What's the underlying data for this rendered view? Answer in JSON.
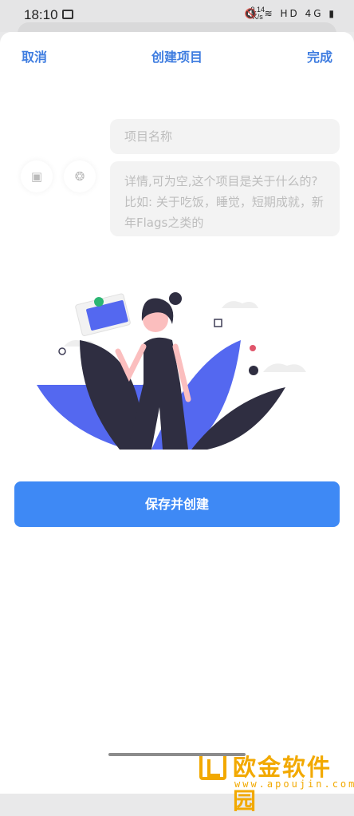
{
  "status": {
    "time": "18:10",
    "net_speed_top": "9.14",
    "net_speed_bottom": "K/s",
    "hd": "HD",
    "signal": "4G"
  },
  "header": {
    "cancel": "取消",
    "title": "创建项目",
    "done": "完成"
  },
  "form": {
    "name_placeholder": "项目名称",
    "desc_placeholder": "详情,可为空,这个项目是关于什么的? 比如: 关于吃饭，睡觉，短期成就，新年Flags之类的"
  },
  "buttons": {
    "save": "保存并创建"
  },
  "watermark": {
    "name": "欧金软件园",
    "url": "www.apoujin.com"
  },
  "colors": {
    "accent": "#3e89f5",
    "header_text": "#3f7de0",
    "illustration_blue": "#5468f0",
    "illustration_dark": "#2f2e41"
  },
  "icons": [
    "image-icon",
    "palette-icon",
    "email-icon"
  ]
}
